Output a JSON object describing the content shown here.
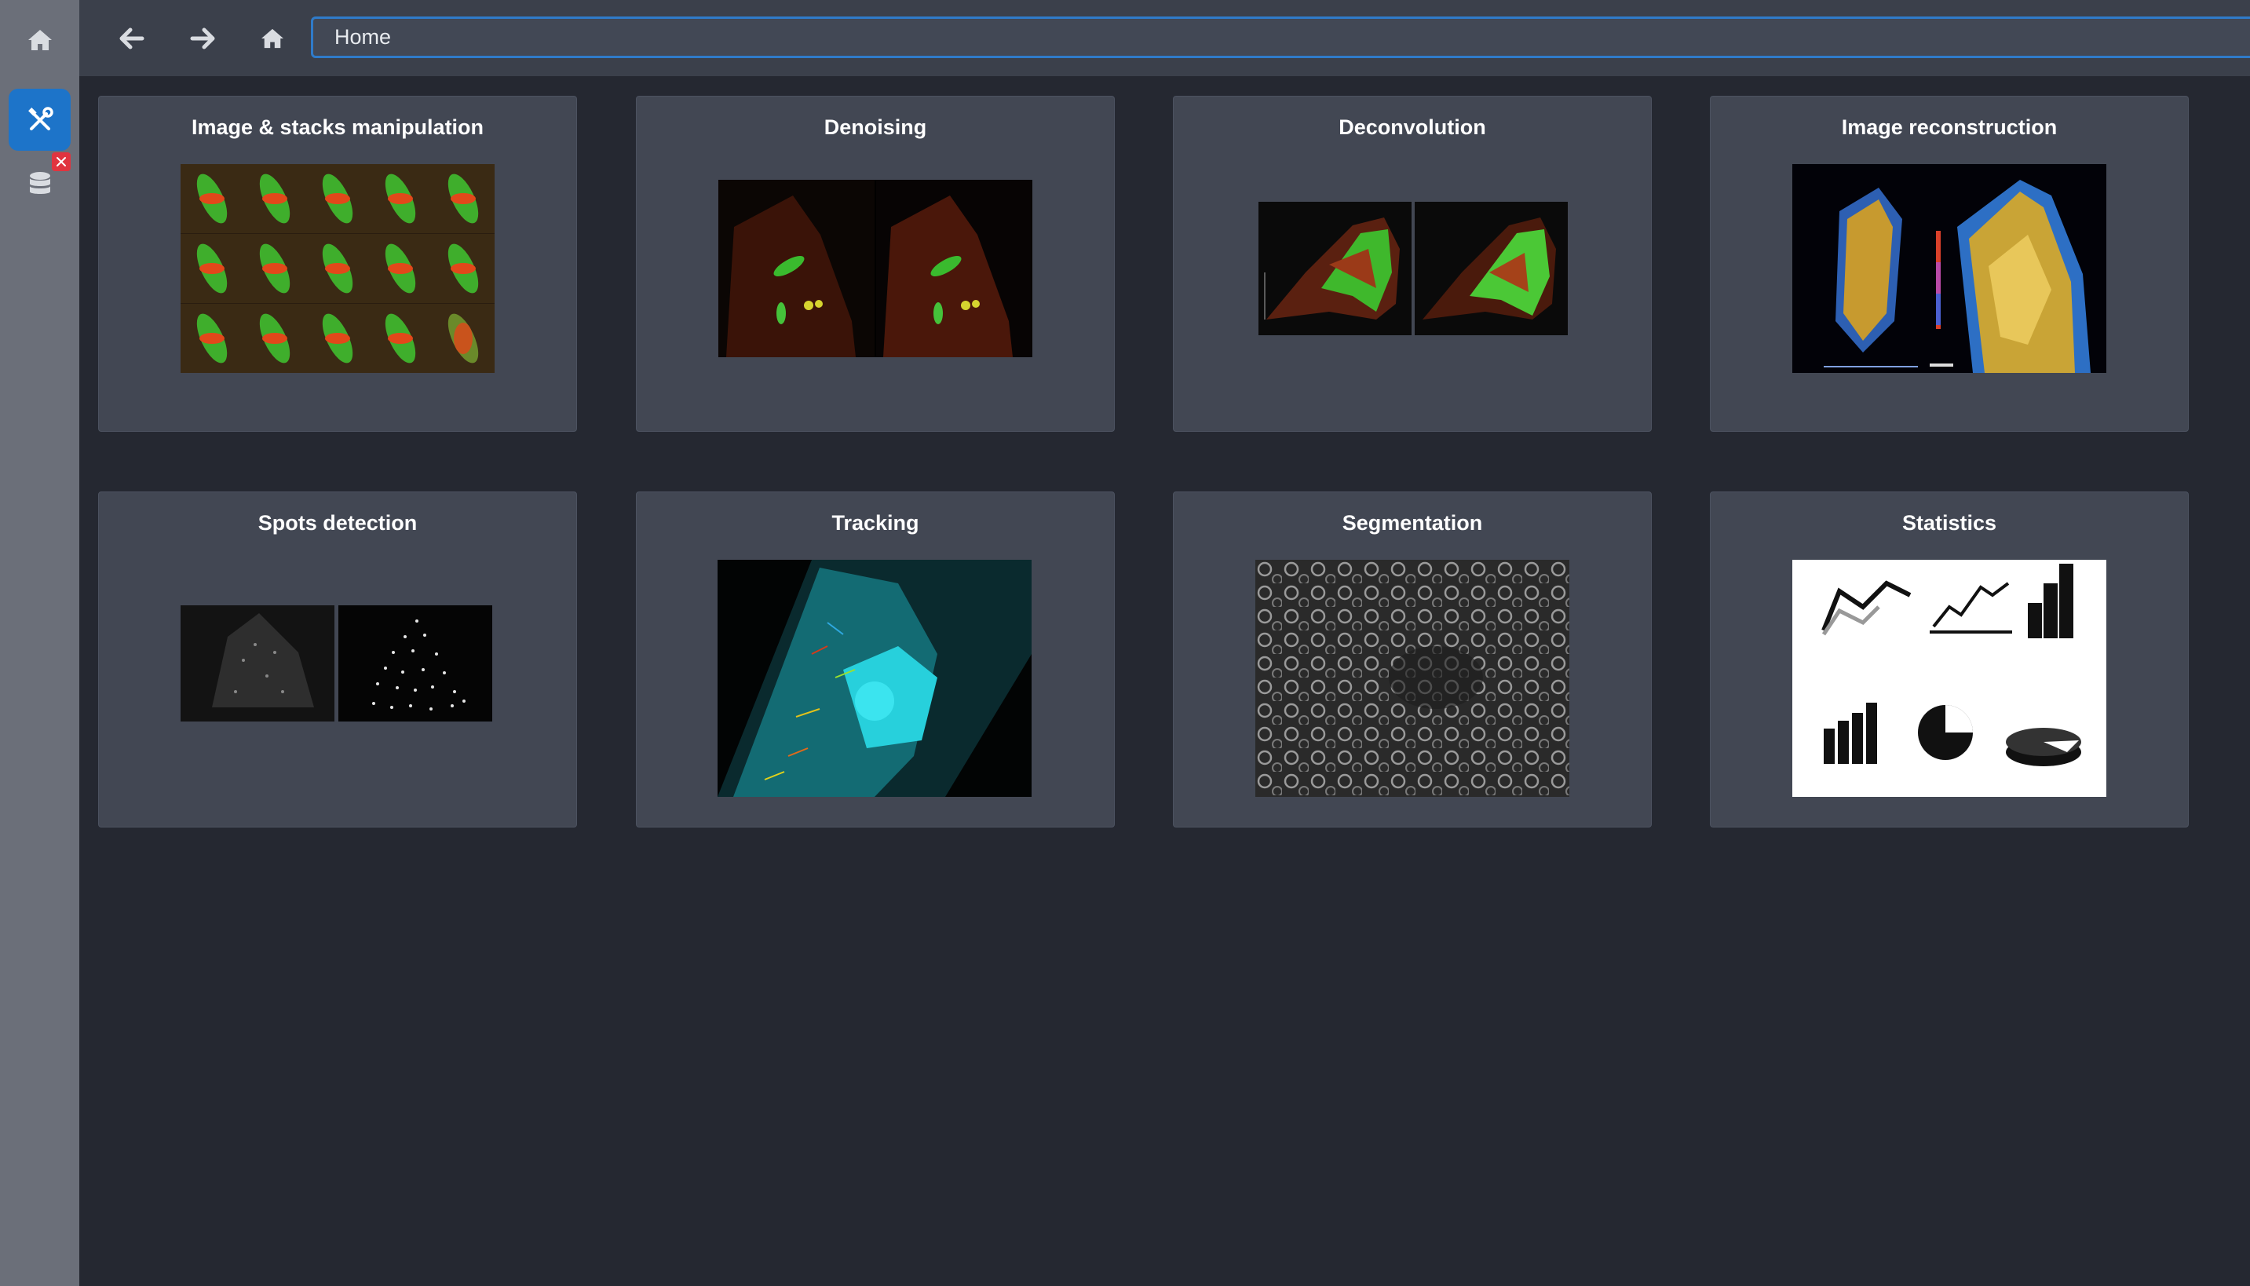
{
  "sidebar": {
    "items": [
      {
        "name": "home",
        "icon": "home-icon"
      },
      {
        "name": "tools",
        "icon": "tools-icon",
        "active": true
      },
      {
        "name": "database",
        "icon": "database-icon",
        "badge": "close-icon"
      }
    ],
    "accent": "#1d74c9",
    "badge_color": "#e0343f"
  },
  "toolbar": {
    "back_icon": "arrow-left-icon",
    "forward_icon": "arrow-right-icon",
    "home_icon": "home-icon",
    "address_value": "Home"
  },
  "cards": [
    {
      "title": "Image & stacks manipulation"
    },
    {
      "title": "Denoising"
    },
    {
      "title": "Deconvolution"
    },
    {
      "title": "Image reconstruction"
    },
    {
      "title": "Spots detection"
    },
    {
      "title": "Tracking"
    },
    {
      "title": "Segmentation"
    },
    {
      "title": "Statistics"
    }
  ]
}
